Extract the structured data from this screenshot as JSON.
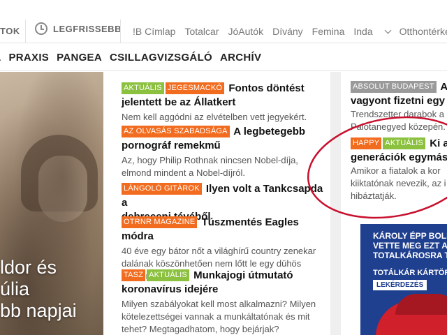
{
  "topbar": {
    "cut_label": "TOK",
    "latest_label": "LEGFRISSEBB",
    "links": [
      "!B Címlap",
      "Totalcar",
      "JóAutók",
      "Dívány",
      "Femina",
      "Inda",
      "Otthontérkép"
    ]
  },
  "section_nav": {
    "items": [
      "L",
      "PRAXIS",
      "PANGEA",
      "CSILLAGVIZSGÁLÓ",
      "ARCHÍV"
    ]
  },
  "hero": {
    "lines": [
      "ldor és",
      "úlia",
      "bb napjai"
    ]
  },
  "articles": [
    {
      "tags": [
        {
          "label": "AKTUÁLIS",
          "color": "green"
        },
        {
          "label": "JEGESMACKÓ",
          "color": "orange"
        }
      ],
      "title_1": "Fontos döntést",
      "title_2": "jelentett be az Állatkert",
      "lead": [
        "Nem kell aggódni az elvételben vett jegyekért."
      ]
    },
    {
      "tags": [
        {
          "label": "AZ OLVASÁS SZABADSÁGA",
          "color": "orange"
        }
      ],
      "title_1": "A legbetegebb",
      "title_2": "pornográf remekmű",
      "lead": [
        "Az, hogy Philip Rothnak nincsen Nobel-díja,",
        "elmond mindent a Nobel-díjról."
      ]
    },
    {
      "tags": [
        {
          "label": "LÁNGOLÓ GITÁROK",
          "color": "orange"
        }
      ],
      "title_1": "Ilyen volt a Tankcsapda a",
      "title_2": "debreceni tévéből",
      "lead": []
    },
    {
      "tags": [
        {
          "label": "OTRNR MAGAZINE",
          "color": "orange"
        }
      ],
      "title_1": "Túszmentés Eagles módra",
      "title_2": "",
      "lead": [
        "40 éve egy bátor nőt a világhírű country zenekar",
        "dalának köszönhetően nem lőtt le egy dühös",
        "kamionsofőr."
      ]
    },
    {
      "tags": [
        {
          "label": "TASZ",
          "color": "orange"
        },
        {
          "label": "AKTUÁLIS",
          "color": "green"
        }
      ],
      "title_1": "Munkajogi útmutató",
      "title_2": "koronavírus idejére",
      "lead": [
        "Milyen szabályokat kell most alkalmazni? Milyen",
        "kötelezettségei vannak a munkáltatónak és mit",
        "tehet? Megtagadhatom, hogy bejárjak?"
      ]
    }
  ],
  "right_articles": [
    {
      "tags": [
        {
          "label": "ABSOLUT BUDAPEST",
          "color": "grey"
        }
      ],
      "title_1": "Aho",
      "title_2": "vagyont fizetni egy e",
      "lead": [
        "Trendszetter darabok a",
        "Palotanegyed közepén."
      ]
    },
    {
      "tags": [
        {
          "label": "HAPPY",
          "color": "orange"
        },
        {
          "label": "AKTUÁLIS",
          "color": "green"
        }
      ],
      "title_1": "Ki a h",
      "title_2": "generációk egymást",
      "lead": [
        "Amikor a fiatalok a kor",
        "kiiktatónak nevezik, az i",
        "hibáztatják."
      ]
    }
  ],
  "ad": {
    "line1": "KÁROLY ÉPP BOLD",
    "line2": "VETTE MEG EZT A H",
    "line3": "TOTALKÁROSRA TO",
    "line4": "TOTÁLKÁR KÁRTÖRTÉ",
    "button": "LEKÉRDEZÉS"
  },
  "colors": {
    "tag_green": "#8bc13f",
    "tag_orange": "#f26c1f",
    "tag_grey": "#9a9a9a",
    "annotation_red": "#c8102e",
    "ad_blue": "#1f3f8f"
  }
}
